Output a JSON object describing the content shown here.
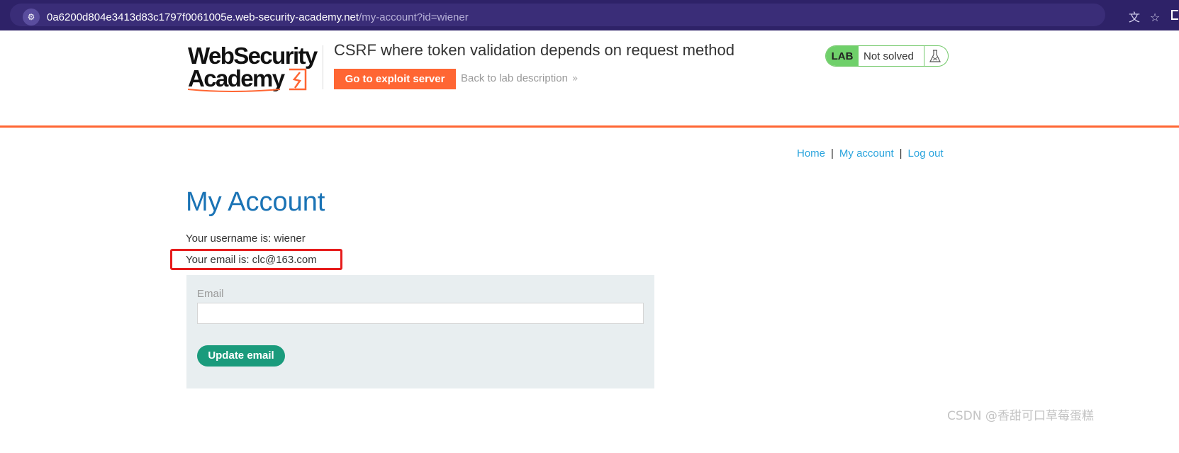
{
  "browser": {
    "url_host": "0a6200d804e3413d83c1797f0061005e.web-security-academy.net",
    "url_path": "/my-account?id=wiener"
  },
  "lab": {
    "logo_line1": "WebSecurity",
    "logo_line2": "Academy",
    "title": "CSRF where token validation depends on request method",
    "exploit_button": "Go to exploit server",
    "back_link": "Back to lab description",
    "badge": "LAB",
    "status": "Not solved"
  },
  "nav": {
    "home": "Home",
    "separator": "|",
    "my_account": "My account",
    "log_out": "Log out"
  },
  "account": {
    "heading": "My Account",
    "username_line": "Your username is: wiener",
    "email_line": "Your email is: clc@163.com"
  },
  "form": {
    "email_label": "Email",
    "email_value": "",
    "submit_label": "Update email"
  },
  "colors": {
    "brand_orange": "#ff6633",
    "heading_blue": "#1a73b5",
    "link_blue": "#2ba4dd",
    "button_teal": "#1a9b7c",
    "status_green": "#6fd06a",
    "highlight_red": "#e61c1c"
  },
  "watermark": "CSDN @香甜可口草莓蛋糕"
}
